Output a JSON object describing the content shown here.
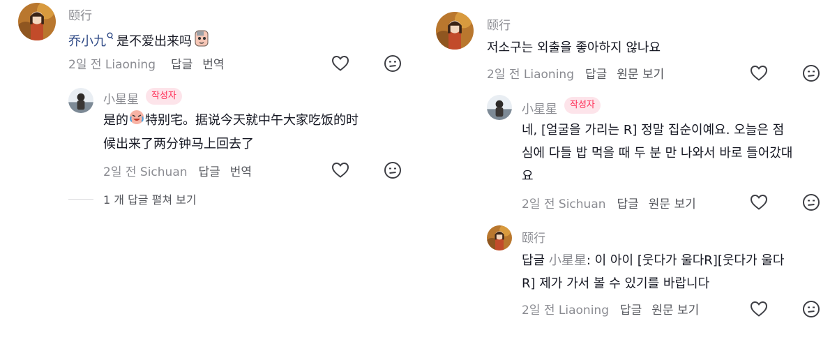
{
  "left": {
    "comment": {
      "username": "颐行",
      "mention": "乔小九",
      "text": "是不爱出来吗",
      "date": "2일 전",
      "location": "Liaoning",
      "reply_label": "답글",
      "translate_label": "번역"
    },
    "reply": {
      "username": "小星星",
      "author_tag": "작성자",
      "text_before": "是的",
      "text_line1_after": "特别宅。据说今天就中午大家吃饭的时",
      "text_line2": "候出来了两分钟马上回去了",
      "date": "2일 전",
      "location": "Sichuan",
      "reply_label": "답글",
      "translate_label": "번역"
    },
    "expand_label": "1 개 답글 펼쳐 보기"
  },
  "right": {
    "comment": {
      "username": "颐行",
      "text": "저소구는 외출을 좋아하지 않나요",
      "date": "2일 전",
      "location": "Liaoning",
      "reply_label": "답글",
      "original_label": "원문 보기"
    },
    "reply": {
      "username": "小星星",
      "author_tag": "작성자",
      "line1": "네, [얼굴을 가리는 R] 정말 집순이예요. 오늘은 점",
      "line2": "심에 다들 밥 먹을 때 두 분 만 나와서 바로 들어갔대",
      "line3": "요",
      "date": "2일 전",
      "location": "Sichuan",
      "reply_label": "답글",
      "original_label": "원문 보기"
    },
    "reply2": {
      "username": "颐行",
      "prefix": "답글",
      "mention": "小星星",
      "line1_after": ": 이 아이 [웃다가 울다R][웃다가 울다",
      "line2": "R] 제가 가서 볼 수 있기를 바랍니다",
      "date": "2일 전",
      "location": "Liaoning",
      "reply_label": "답글",
      "original_label": "원문 보기"
    }
  },
  "icons": {
    "like": "heart-outline-icon",
    "dislike": "meh-face-icon",
    "mention_suffix": "q-badge-icon",
    "emoji_head": "cartoon-head-emoji",
    "emoji_cry": "laugh-cry-emoji"
  },
  "colors": {
    "text": "#161823",
    "muted": "#8a8b91",
    "tag_bg": "#fde4ea",
    "tag_fg": "#fe2c55",
    "mention": "#2f4a86"
  }
}
